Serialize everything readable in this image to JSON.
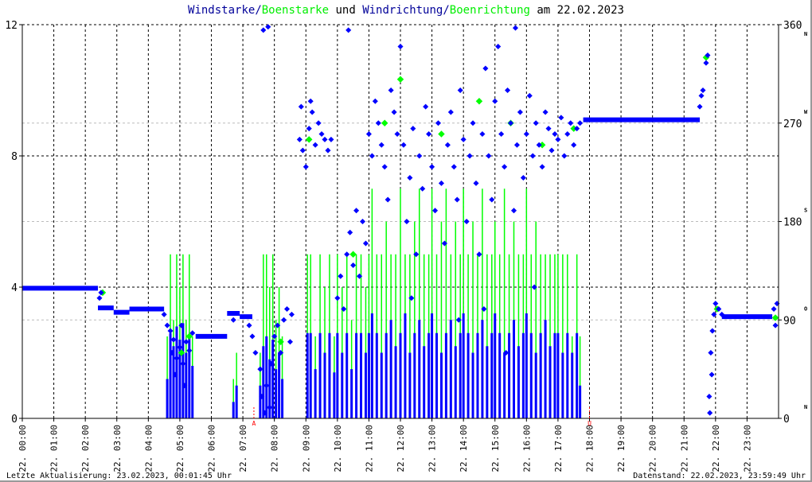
{
  "title": {
    "part1": "Windstarke",
    "sep1": "/",
    "part2": "Boenstarke",
    "mid": " und ",
    "part3": "Windrichtung",
    "sep2": "/",
    "part4": "Boenrichtung",
    "tail": " am 22.02.2023"
  },
  "footer": {
    "left": "Letzte Aktualisierung: 23.02.2023, 00:01:45 Uhr",
    "right": "Datenstand: 22.02.2023, 23:59:49 Uhr"
  },
  "colors": {
    "wind": "#0000ff",
    "gust": "#00ff00",
    "marker": "#ff0000",
    "title_wind": "#000099"
  },
  "chart_data": {
    "type": "scatter",
    "title": "Windstarke/Boenstarke und Windrichtung/Boenrichtung am 22.02.2023",
    "xlim": [
      0,
      24
    ],
    "ylim_left": [
      0,
      12
    ],
    "ylim_right": [
      0,
      360
    ],
    "x_ticks": [
      "22. 00:00",
      "22. 01:00",
      "22. 02:00",
      "22. 03:00",
      "22. 04:00",
      "22. 05:00",
      "22. 06:00",
      "22. 07:00",
      "22. 08:00",
      "22. 09:00",
      "22. 10:00",
      "22. 11:00",
      "22. 12:00",
      "22. 13:00",
      "22. 14:00",
      "22. 15:00",
      "22. 16:00",
      "22. 17:00",
      "22. 18:00",
      "22. 19:00",
      "22. 20:00",
      "22. 21:00",
      "22. 22:00",
      "22. 23:00"
    ],
    "left_ticks": [
      "0",
      "4",
      "8",
      "12"
    ],
    "right_ticks": [
      {
        "v": "0",
        "d": "N"
      },
      {
        "v": "90",
        "d": "O"
      },
      {
        "v": "180",
        "d": "S"
      },
      {
        "v": "270",
        "d": "W"
      },
      {
        "v": "360",
        "d": "N"
      }
    ],
    "markers": [
      {
        "label": "A",
        "hour": 7.35
      },
      {
        "label": "U",
        "hour": 18.0
      }
    ],
    "direction_plateaus": [
      [
        0,
        2.4,
        119
      ],
      [
        2.4,
        2.9,
        101
      ],
      [
        2.9,
        3.4,
        97
      ],
      [
        3.4,
        4.5,
        100
      ],
      [
        5.5,
        6.5,
        75
      ],
      [
        6.5,
        6.9,
        96
      ],
      [
        6.9,
        7.3,
        93
      ],
      [
        17.8,
        21.5,
        273
      ],
      [
        22.2,
        23.8,
        93
      ]
    ],
    "direction_points": [
      [
        2.45,
        110
      ],
      [
        2.5,
        115
      ],
      [
        4.5,
        95
      ],
      [
        4.6,
        85
      ],
      [
        4.7,
        80
      ],
      [
        4.75,
        60
      ],
      [
        4.8,
        72
      ],
      [
        4.85,
        40
      ],
      [
        4.9,
        55
      ],
      [
        5.0,
        65
      ],
      [
        5.05,
        85
      ],
      [
        5.1,
        50
      ],
      [
        5.15,
        30
      ],
      [
        5.2,
        70
      ],
      [
        5.3,
        62
      ],
      [
        5.4,
        78
      ],
      [
        6.7,
        90
      ],
      [
        7.2,
        85
      ],
      [
        7.3,
        75
      ],
      [
        7.4,
        60
      ],
      [
        7.55,
        45
      ],
      [
        7.6,
        20
      ],
      [
        7.65,
        355
      ],
      [
        7.7,
        5
      ],
      [
        7.75,
        30
      ],
      [
        7.8,
        358
      ],
      [
        7.85,
        10
      ],
      [
        7.9,
        50
      ],
      [
        8.0,
        75
      ],
      [
        8.1,
        85
      ],
      [
        8.2,
        60
      ],
      [
        8.3,
        90
      ],
      [
        8.4,
        100
      ],
      [
        8.5,
        70
      ],
      [
        8.55,
        95
      ],
      [
        8.8,
        255
      ],
      [
        8.85,
        285
      ],
      [
        8.9,
        245
      ],
      [
        9.0,
        230
      ],
      [
        9.1,
        265
      ],
      [
        9.15,
        290
      ],
      [
        9.2,
        280
      ],
      [
        9.3,
        250
      ],
      [
        9.4,
        270
      ],
      [
        9.5,
        260
      ],
      [
        9.6,
        255
      ],
      [
        9.7,
        245
      ],
      [
        9.8,
        255
      ],
      [
        10.0,
        110
      ],
      [
        10.1,
        130
      ],
      [
        10.2,
        100
      ],
      [
        10.3,
        150
      ],
      [
        10.35,
        355
      ],
      [
        10.4,
        170
      ],
      [
        10.5,
        140
      ],
      [
        10.6,
        190
      ],
      [
        10.7,
        130
      ],
      [
        10.8,
        180
      ],
      [
        10.9,
        160
      ],
      [
        11.0,
        260
      ],
      [
        11.1,
        240
      ],
      [
        11.2,
        290
      ],
      [
        11.3,
        270
      ],
      [
        11.4,
        250
      ],
      [
        11.5,
        230
      ],
      [
        11.6,
        200
      ],
      [
        11.7,
        300
      ],
      [
        11.8,
        280
      ],
      [
        11.9,
        260
      ],
      [
        12.0,
        340
      ],
      [
        12.1,
        250
      ],
      [
        12.2,
        180
      ],
      [
        12.3,
        220
      ],
      [
        12.35,
        110
      ],
      [
        12.4,
        265
      ],
      [
        12.5,
        150
      ],
      [
        12.6,
        240
      ],
      [
        12.7,
        210
      ],
      [
        12.8,
        285
      ],
      [
        12.9,
        260
      ],
      [
        13.0,
        230
      ],
      [
        13.1,
        190
      ],
      [
        13.2,
        270
      ],
      [
        13.3,
        215
      ],
      [
        13.4,
        160
      ],
      [
        13.5,
        250
      ],
      [
        13.6,
        280
      ],
      [
        13.7,
        230
      ],
      [
        13.8,
        200
      ],
      [
        13.85,
        90
      ],
      [
        13.9,
        300
      ],
      [
        14.0,
        255
      ],
      [
        14.1,
        180
      ],
      [
        14.2,
        240
      ],
      [
        14.3,
        270
      ],
      [
        14.4,
        215
      ],
      [
        14.5,
        150
      ],
      [
        14.6,
        260
      ],
      [
        14.65,
        100
      ],
      [
        14.7,
        320
      ],
      [
        14.8,
        240
      ],
      [
        14.9,
        200
      ],
      [
        15.0,
        290
      ],
      [
        15.1,
        340
      ],
      [
        15.2,
        260
      ],
      [
        15.3,
        230
      ],
      [
        15.35,
        60
      ],
      [
        15.4,
        300
      ],
      [
        15.5,
        270
      ],
      [
        15.6,
        190
      ],
      [
        15.65,
        357
      ],
      [
        15.7,
        250
      ],
      [
        15.8,
        280
      ],
      [
        15.9,
        220
      ],
      [
        16.0,
        260
      ],
      [
        16.1,
        295
      ],
      [
        16.2,
        240
      ],
      [
        16.25,
        120
      ],
      [
        16.3,
        270
      ],
      [
        16.4,
        250
      ],
      [
        16.5,
        230
      ],
      [
        16.6,
        280
      ],
      [
        16.7,
        265
      ],
      [
        16.8,
        245
      ],
      [
        16.9,
        260
      ],
      [
        17.0,
        255
      ],
      [
        17.1,
        275
      ],
      [
        17.2,
        240
      ],
      [
        17.3,
        260
      ],
      [
        17.4,
        270
      ],
      [
        17.5,
        250
      ],
      [
        17.6,
        265
      ],
      [
        17.7,
        270
      ],
      [
        21.5,
        285
      ],
      [
        21.55,
        295
      ],
      [
        21.6,
        300
      ],
      [
        21.7,
        325
      ],
      [
        21.75,
        332
      ],
      [
        21.8,
        20
      ],
      [
        21.82,
        5
      ],
      [
        21.85,
        60
      ],
      [
        21.88,
        40
      ],
      [
        21.9,
        80
      ],
      [
        21.95,
        95
      ],
      [
        22.0,
        105
      ],
      [
        22.1,
        100
      ],
      [
        22.2,
        95
      ],
      [
        23.85,
        100
      ],
      [
        23.9,
        85
      ],
      [
        23.95,
        105
      ]
    ],
    "gust_direction_points": [
      [
        2.55,
        115
      ],
      [
        5.05,
        60
      ],
      [
        5.3,
        75
      ],
      [
        8.2,
        70
      ],
      [
        9.1,
        255
      ],
      [
        10.5,
        150
      ],
      [
        11.5,
        270
      ],
      [
        12.0,
        310
      ],
      [
        13.3,
        260
      ],
      [
        14.5,
        290
      ],
      [
        15.5,
        270
      ],
      [
        16.5,
        250
      ],
      [
        17.5,
        265
      ],
      [
        21.7,
        330
      ],
      [
        22.05,
        100
      ],
      [
        23.9,
        92
      ]
    ],
    "speed_series": [
      [
        4.6,
        1.2,
        2.5
      ],
      [
        4.7,
        2.6,
        5
      ],
      [
        4.8,
        2.2,
        3
      ],
      [
        4.9,
        2.8,
        5
      ],
      [
        5.0,
        2.4,
        4
      ],
      [
        5.1,
        2.9,
        5
      ],
      [
        5.2,
        2.0,
        3
      ],
      [
        5.3,
        2.5,
        5
      ],
      [
        5.4,
        1.6,
        2.5
      ],
      [
        6.7,
        0.5,
        1.2
      ],
      [
        6.8,
        1.0,
        2
      ],
      [
        7.55,
        1.0,
        2
      ],
      [
        7.65,
        2.2,
        5
      ],
      [
        7.75,
        2.5,
        5
      ],
      [
        7.85,
        1.8,
        4
      ],
      [
        7.95,
        2.4,
        5
      ],
      [
        8.05,
        1.5,
        3
      ],
      [
        8.15,
        2.0,
        4
      ],
      [
        8.25,
        1.2,
        2.5
      ],
      [
        9.05,
        2.6,
        5
      ],
      [
        9.15,
        2.6,
        5
      ],
      [
        9.3,
        1.5,
        2.5
      ],
      [
        9.45,
        2.6,
        5
      ],
      [
        9.6,
        2.0,
        4
      ],
      [
        9.75,
        2.6,
        5
      ],
      [
        9.9,
        1.4,
        2.5
      ],
      [
        10.0,
        2.6,
        5
      ],
      [
        10.15,
        2.0,
        4
      ],
      [
        10.3,
        2.6,
        5
      ],
      [
        10.45,
        1.5,
        3
      ],
      [
        10.6,
        2.6,
        5
      ],
      [
        10.75,
        2.6,
        5
      ],
      [
        10.9,
        2.0,
        4
      ],
      [
        11.0,
        2.6,
        5
      ],
      [
        11.1,
        3.2,
        7
      ],
      [
        11.25,
        2.6,
        5
      ],
      [
        11.4,
        2.0,
        5
      ],
      [
        11.55,
        2.6,
        6
      ],
      [
        11.7,
        3.0,
        5
      ],
      [
        11.85,
        2.2,
        5
      ],
      [
        12.0,
        2.6,
        7
      ],
      [
        12.15,
        3.2,
        5
      ],
      [
        12.3,
        2.0,
        5
      ],
      [
        12.45,
        2.6,
        6
      ],
      [
        12.6,
        3.0,
        7
      ],
      [
        12.75,
        2.2,
        5
      ],
      [
        12.9,
        2.6,
        5
      ],
      [
        13.0,
        3.2,
        7
      ],
      [
        13.15,
        2.6,
        5
      ],
      [
        13.3,
        2.0,
        6
      ],
      [
        13.45,
        2.6,
        7
      ],
      [
        13.6,
        3.0,
        5
      ],
      [
        13.75,
        2.2,
        6
      ],
      [
        13.9,
        2.6,
        5
      ],
      [
        14.0,
        3.2,
        7
      ],
      [
        14.15,
        2.6,
        5
      ],
      [
        14.3,
        2.0,
        6
      ],
      [
        14.45,
        2.6,
        5
      ],
      [
        14.6,
        3.0,
        7
      ],
      [
        14.75,
        2.2,
        5
      ],
      [
        14.9,
        2.6,
        5
      ],
      [
        15.0,
        3.2,
        6
      ],
      [
        15.15,
        2.6,
        5
      ],
      [
        15.3,
        2.0,
        7
      ],
      [
        15.45,
        2.6,
        5
      ],
      [
        15.6,
        3.0,
        6
      ],
      [
        15.75,
        2.2,
        5
      ],
      [
        15.9,
        2.6,
        5
      ],
      [
        16.0,
        3.2,
        7
      ],
      [
        16.15,
        2.6,
        5
      ],
      [
        16.3,
        2.0,
        6
      ],
      [
        16.45,
        2.6,
        5
      ],
      [
        16.6,
        3.0,
        5
      ],
      [
        16.75,
        2.2,
        5
      ],
      [
        16.9,
        2.6,
        5
      ],
      [
        17.0,
        2.6,
        5
      ],
      [
        17.15,
        2.0,
        5
      ],
      [
        17.3,
        2.6,
        5
      ],
      [
        17.45,
        2.0,
        2.5
      ],
      [
        17.6,
        2.6,
        5
      ],
      [
        17.7,
        1.0,
        2.5
      ]
    ]
  }
}
